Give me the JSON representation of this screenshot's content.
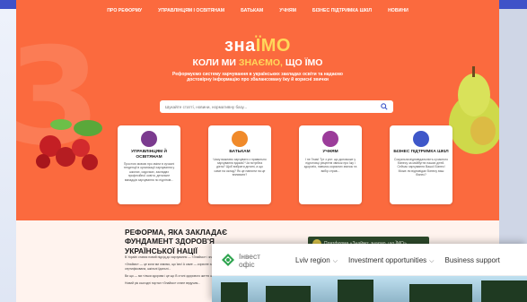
{
  "nav": {
    "items": [
      "ПРО РЕФОРМУ",
      "УПРАВЛІНЦЯМ І ОСВІТЯНАМ",
      "БАТЬКАМ",
      "УЧНЯМ",
      "БІЗНЕС ПІДТРИМКА ШКІЛ",
      "НОВИНИ"
    ]
  },
  "hero": {
    "logo_prefix": "зна",
    "logo_suffix": "ЇМО",
    "tagline_prefix": "КОЛИ МИ",
    "tagline_highlight": "ЗНАЄМО,",
    "tagline_suffix": "ЩО ЇМО",
    "description": "Реформуємо систему харчування в українських закладах освіти та надаємо достовірну інформацію про збалансовану їжу й корисні звички",
    "search_placeholder": "Шукайте статті, новини, нормативну базу..."
  },
  "cards": [
    {
      "title": "УПРАВЛІНЦЯМ Й ОСВІТЯНАМ",
      "text": "Простою мовою про зміни в сучасні тенденції в організації харчування у школах, садочках, закладах професійної освіти, детальне ванадців харчування по підлітків...",
      "color": "#7b3b8f"
    },
    {
      "title": "БАТЬКАМ",
      "text": "Чому важливо харчувати з правильно харчування вдома? Чи потрібна дієта? Щоб вибрати дитині, а що саме на склад? Як це навчити на це впливати?",
      "color": "#f08a2a"
    },
    {
      "title": "УЧНЯМ",
      "text": "І не Гнам! Тут з усе: що допоможе у підготовці рецептів звичок про їжу і здоров'я, навчись корисних звичок та вибір страв...",
      "color": "#9b3c9a"
    },
    {
      "title": "БІЗНЕС ПІДТРИМКА ШКІЛ",
      "text": "Соціальна відповідальність сучасного бізнесу за майбутнє наших дітей. Сейчас харчування Вашої Бізнес! Може ли відповідає бізнесу ваш бізнес?",
      "color": "#3e57c9"
    }
  ],
  "section": {
    "heading_line1": "РЕФОРМА, ЯКА ЗАКЛАДАЄ",
    "heading_line2": "ФУНДАМЕНТ ЗДОРОВ'Я",
    "heading_line3": "УКРАЇНСЬКОЇ НАЦІЇ",
    "para1": "В Україні стався новий підхід до харчування — «Знаймо» і знаємо що їмо зміни.",
    "para2": "«Знаймо» — це коли ми знаємо, що їмо! А саме — корисне харчування в навчальних закладах, продукти перевірені і сертифікована, шкільні їдальні...",
    "para3": "Ви що — ми тільки здорова і це що В стилі здорового життя що...",
    "para4": "Новий рік сьогодні портал «Знаймо» стане ведучим..."
  },
  "video": {
    "title": "Платформа «Знаймо: знаємо, що ЇМО»"
  },
  "invest": {
    "brand_line1": "Інвест",
    "brand_line2": "офіс",
    "menu": [
      "Lviv region",
      "Investment opportunities",
      "Business support"
    ]
  },
  "colors": {
    "hero_bg": "#fb6a3e",
    "accent_yellow": "#ffd75a",
    "invest_green": "#2ea44f"
  }
}
